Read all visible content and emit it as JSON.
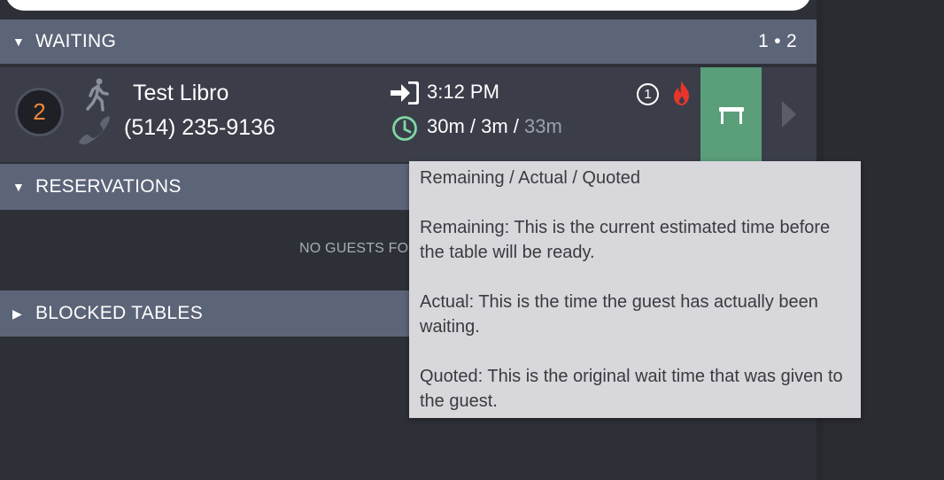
{
  "sections": {
    "waiting": {
      "label": "WAITING",
      "count": "1 • 2"
    },
    "reservations": {
      "label": "RESERVATIONS",
      "empty_text": "NO GUESTS FO"
    },
    "blocked": {
      "label": "BLOCKED TABLES"
    }
  },
  "guest": {
    "party_size": "2",
    "name": "Test Libro",
    "phone": "(514) 235-9136",
    "arrival_time": "3:12 PM",
    "wait_remaining_actual": "30m / 3m /",
    "wait_quoted": "33m",
    "alert_count": "1",
    "icons": {
      "walkin": "walking-person-icon",
      "phone": "phone-icon",
      "arrival": "arrival-icon",
      "clock": "clock-icon",
      "alert": "alert-circle-icon",
      "fire": "fire-icon",
      "table": "table-icon",
      "expand": "chevron-right-icon"
    }
  },
  "tooltip": {
    "title": "Remaining / Actual / Quoted",
    "remaining": "Remaining: This is the current estimated time before the table will be ready.",
    "actual": "Actual: This is the time the guest has actually been waiting.",
    "quoted": "Quoted: This is the original wait time that was given to the guest."
  },
  "colors": {
    "header_bg": "#5c6478",
    "row_bg": "#3b3e49",
    "seat_button": "#5a9e7a",
    "party_size_text": "#f0873a",
    "clock": "#7fd6a4",
    "fire": "#e8352c"
  }
}
